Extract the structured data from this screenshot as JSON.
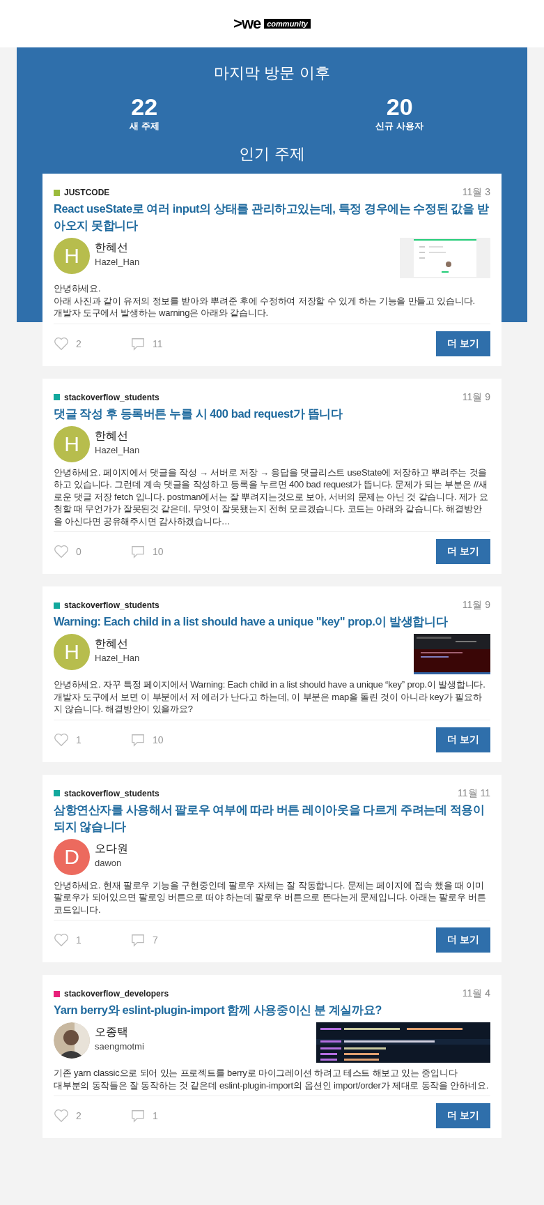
{
  "logo": {
    "mark": ">we",
    "tag": "community"
  },
  "summary": {
    "title": "마지막 방문 이후",
    "stats": [
      {
        "value": "22",
        "label": "새 주제"
      },
      {
        "value": "20",
        "label": "신규 사용자"
      }
    ]
  },
  "section_title": "인기 주제",
  "topics": [
    {
      "category": "JUSTCODE",
      "color": "#9bbb3c",
      "date": "11월 3",
      "title": "React useState로 여러 input의 상태를 관리하고있는데, 특정 경우에는 수정된 값을 받아오지 못합니다",
      "author": {
        "name": "한혜선",
        "username": "Hazel_Han",
        "avatar": {
          "kind": "letter",
          "letter": "H",
          "color": "#b7bd4d"
        }
      },
      "excerpt": "안녕하세요.\n아래 사진과 같이 유저의 정보를 받아와 뿌려준 후에 수정하여 저장할 수 있게 하는 기능을 만들고 있습니다.\n개발자 도구에서 발생하는 warning은 아래와 같습니다.",
      "likes": "2",
      "comments": "11",
      "button": "더 보기"
    },
    {
      "category": "stackoverflow_students",
      "color": "#12a89d",
      "date": "11월 9",
      "title": "댓글 작성 후 등록버튼 누를 시 400 bad request가 뜹니다",
      "author": {
        "name": "한혜선",
        "username": "Hazel_Han",
        "avatar": {
          "kind": "letter",
          "letter": "H",
          "color": "#b7bd4d"
        }
      },
      "excerpt": "안녕하세요. 페이지에서 댓글을 작성 → 서버로 저장 → 응답을 댓글리스트 useState에 저장하고 뿌려주는 것을 하고 있습니다. 그런데 계속 댓글을 작성하고 등록을 누르면 400 bad request가 뜹니다. 문제가 되는 부분은 //새로운 댓글 저장 fetch 입니다. postman에서는 잘 뿌려지는것으로 보아, 서버의 문제는 아닌 것 같습니다. 제가 요청할 때 무언가가 잘못된것 같은데, 무엇이 잘못됐는지 전혀 모르겠습니다. 코드는 아래와 같습니다. 해결방안을 아신다면 공유해주시면 감사하겠습니다…",
      "likes": "0",
      "comments": "10",
      "button": "더 보기"
    },
    {
      "category": "stackoverflow_students",
      "color": "#12a89d",
      "date": "11월 9",
      "title": "Warning: Each child in a list should have a unique \"key\" prop.이 발생합니다",
      "author": {
        "name": "한혜선",
        "username": "Hazel_Han",
        "avatar": {
          "kind": "letter",
          "letter": "H",
          "color": "#b7bd4d"
        }
      },
      "excerpt": "안녕하세요. 자꾸 특정 페이지에서 Warning: Each child in a list should have a unique “key” prop.이 발생합니다. 개발자 도구에서 보면 이 부분에서 저 에러가 난다고 하는데, 이 부분은 map을 돌린 것이 아니라 key가 필요하지 않습니다. 해결방안이 있을까요?",
      "likes": "1",
      "comments": "10",
      "button": "더 보기"
    },
    {
      "category": "stackoverflow_students",
      "color": "#12a89d",
      "date": "11월 11",
      "title": "삼항연산자를 사용해서 팔로우 여부에 따라 버튼 레이아웃을 다르게 주려는데 적용이 되지 않습니다",
      "author": {
        "name": "오다원",
        "username": "dawon",
        "avatar": {
          "kind": "letter",
          "letter": "D",
          "color": "#ec6a5e"
        }
      },
      "excerpt": "안녕하세요. 현재 팔로우 기능을 구현중인데 팔로우 자체는 잘 작동합니다. 문제는 페이지에 접속 했을 때 이미 팔로우가 되어있으면 팔로잉 버튼으로 떠야 하는데 팔로우 버튼으로 뜬다는게 문제입니다. 아래는 팔로우 버튼 코드입니다.",
      "likes": "1",
      "comments": "7",
      "button": "더 보기"
    },
    {
      "category": "stackoverflow_developers",
      "color": "#e8217a",
      "date": "11월 4",
      "title": "Yarn berry와 eslint-plugin-import 함께 사용중이신 분 계실까요?",
      "author": {
        "name": "오종택",
        "username": "saengmotmi"
      },
      "excerpt": "기존 yarn classic으로 되어 있는 프로젝트를 berry로 마이그레이션 하려고 테스트 해보고 있는 중입니다\n대부분의 동작들은 잘 동작하는 것 같은데 eslint-plugin-import의 옵션인 import/order가 제대로 동작을 안하네요.",
      "likes": "2",
      "comments": "1",
      "button": "더 보기"
    }
  ]
}
